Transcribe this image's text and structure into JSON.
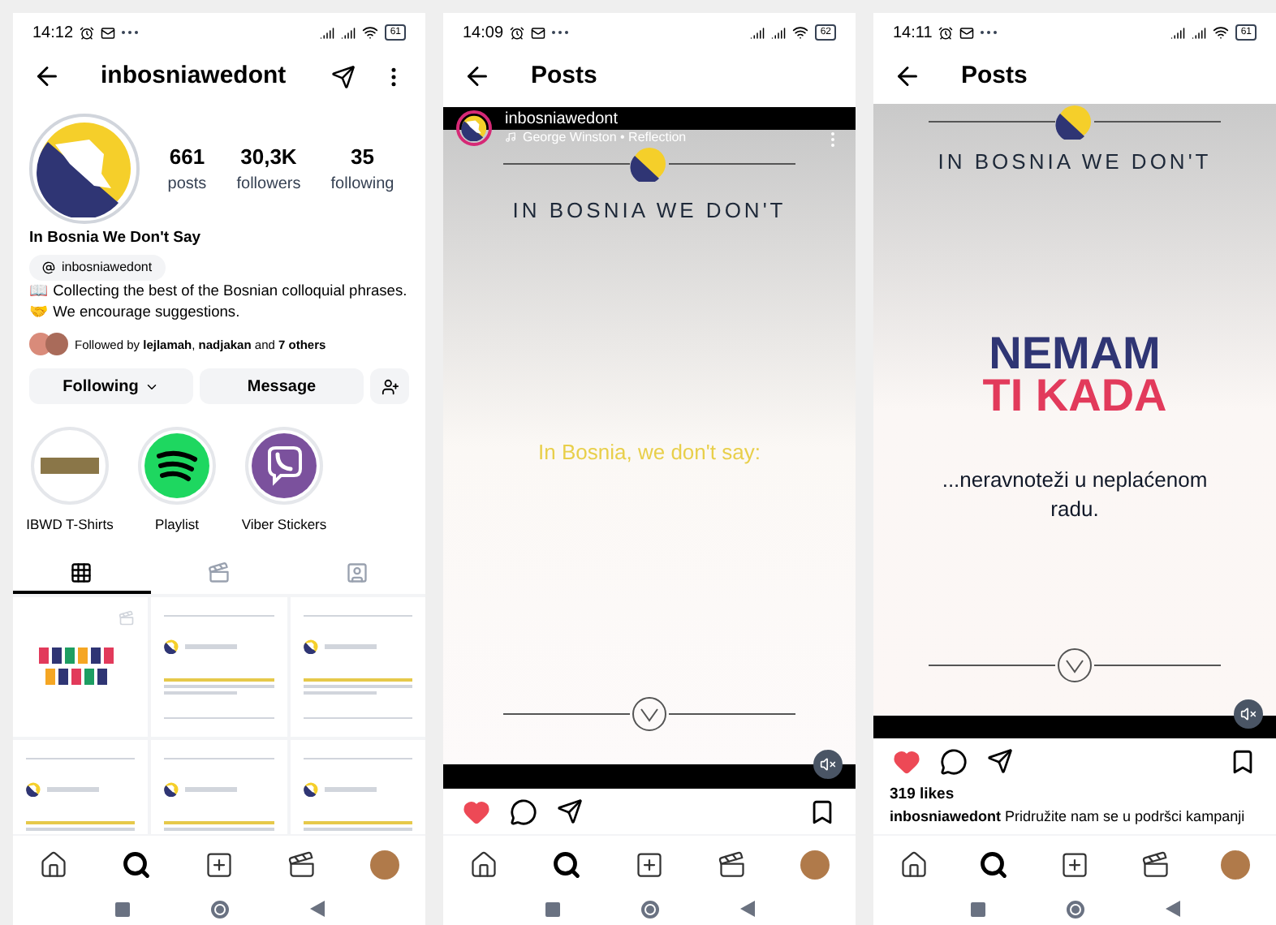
{
  "profile_screen": {
    "status": {
      "time": "14:12",
      "battery": "61"
    },
    "title": "inbosniawedont",
    "stats": [
      {
        "value": "661",
        "label": "posts"
      },
      {
        "value": "30,3K",
        "label": "followers"
      },
      {
        "value": "35",
        "label": "following"
      }
    ],
    "name": "In Bosnia We Don't Say",
    "threads_handle": "inbosniawedont",
    "bio": [
      "📖 Collecting the best of the Bosnian colloquial phrases.",
      "🤝 We encourage suggestions."
    ],
    "followed_by": "Followed by **lejlamah**, **nadjakan** and **7 others**",
    "follow_button": "Following",
    "message_button": "Message",
    "highlights": [
      {
        "kind": "photo",
        "label": "IBWD T-Shirts"
      },
      {
        "kind": "spotify",
        "label": "Playlist"
      },
      {
        "kind": "viber",
        "label": "Viber Stickers"
      }
    ],
    "tabs": [
      {
        "kind": "grid",
        "selected": true
      },
      {
        "kind": "reels",
        "selected": false
      },
      {
        "kind": "tagged",
        "selected": false
      }
    ],
    "grid": [
      {
        "kind": "reel"
      },
      {
        "kind": "text"
      },
      {
        "kind": "text"
      },
      {
        "kind": "text"
      },
      {
        "kind": "text"
      },
      {
        "kind": "text"
      }
    ],
    "nav": [
      {
        "kind": "home",
        "selected": false
      },
      {
        "kind": "search",
        "selected": true
      },
      {
        "kind": "create",
        "selected": false
      },
      {
        "kind": "reels",
        "selected": false
      },
      {
        "kind": "profile",
        "selected": false
      }
    ]
  },
  "post_screen_1": {
    "status": {
      "time": "14:09",
      "battery": "62"
    },
    "title": "Posts",
    "user": "inbosniawedont",
    "music": "George Winston • Reflection",
    "heading": "IN BOSNIA WE DON'T",
    "slide_text": "In Bosnia, we don't say:",
    "muted": true,
    "liked": true,
    "nav": [
      {
        "kind": "home",
        "selected": false
      },
      {
        "kind": "search",
        "selected": true
      },
      {
        "kind": "create",
        "selected": false
      },
      {
        "kind": "reels",
        "selected": false
      },
      {
        "kind": "profile",
        "selected": false
      }
    ]
  },
  "post_screen_2": {
    "status": {
      "time": "14:11",
      "battery": "61"
    },
    "title": "Posts",
    "heading": "IN BOSNIA WE DON'T",
    "logo_lines": [
      "NEMAM",
      "TI KADA"
    ],
    "slide_text": "...neravnoteži u neplaćenom radu.",
    "muted": true,
    "liked": true,
    "likes": "319 likes",
    "caption_user": "inbosniawedont",
    "caption": "Pridružite nam se u podršci kampanji",
    "nav": [
      {
        "kind": "home",
        "selected": false
      },
      {
        "kind": "search",
        "selected": true
      },
      {
        "kind": "create",
        "selected": false
      },
      {
        "kind": "reels",
        "selected": false
      },
      {
        "kind": "profile",
        "selected": false
      }
    ]
  }
}
